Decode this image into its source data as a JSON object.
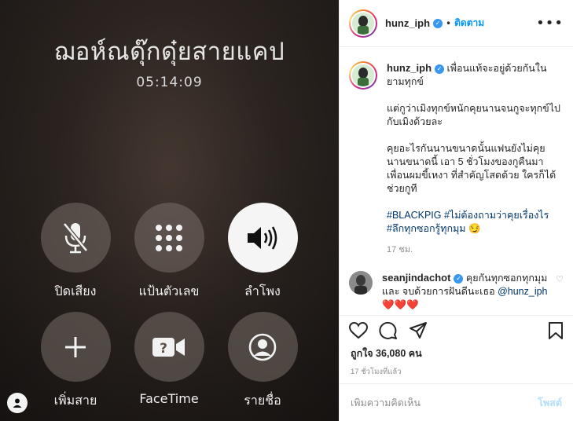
{
  "call_screen": {
    "caller_name": "ฌอห์ณดุ๊กดุ๋ยสายแคป",
    "duration": "05:14:09",
    "controls": [
      {
        "label": "ปิดเสียง",
        "icon": "mic-off-icon",
        "active": false
      },
      {
        "label": "แป้นตัวเลข",
        "icon": "keypad-icon",
        "active": false
      },
      {
        "label": "ลำโพง",
        "icon": "speaker-icon",
        "active": true
      },
      {
        "label": "เพิ่มสาย",
        "icon": "plus-icon",
        "active": false
      },
      {
        "label": "FaceTime",
        "icon": "facetime-icon",
        "active": false
      },
      {
        "label": "รายชื่อ",
        "icon": "contacts-icon",
        "active": false
      }
    ]
  },
  "header": {
    "username": "hunz_iph",
    "dot": "•",
    "follow_label": "ติดตาม",
    "more_label": "•••"
  },
  "caption": {
    "username": "hunz_iph",
    "text_first": "เพื่อนแท้จะอยู่ด้วยกันในยามทุกข์",
    "paragraph2": "แต่กูว่าเมิงทุกข์หนักคุยนานจนกูจะทุกข์ไปกับเมิงด้วยละ",
    "paragraph3": "คุยอะไรกันนานขนาดนั้นแฟนยังไม่คุยนานขนาดนี้ เอา 5 ชั่วโมงของกูคืนมา เพื่อนผมขี้เหงา ที่สำคัญโสดด้วย ใครก็ได้ช่วยกูที",
    "hashtags": "#BLACKPIG #ไม่ต้องถามว่าคุยเรื่องไร #ลึกทุกซอกรู้ทุกมุม 😏",
    "age": "17 ชม."
  },
  "comment": {
    "username": "seanjindachot",
    "text": "คุยกันทุกซอกทุกมุม และ จบด้วยการฝันดีนะเธอ",
    "mention": "@hunz_iph",
    "hearts": "❤️❤️❤️"
  },
  "likes": "ถูกใจ 36,080 คน",
  "timestamp": "17 ชั่วโมงที่แล้ว",
  "add_comment": {
    "placeholder": "เพิ่มความคิดเห็น",
    "post_label": "โพสต์"
  }
}
